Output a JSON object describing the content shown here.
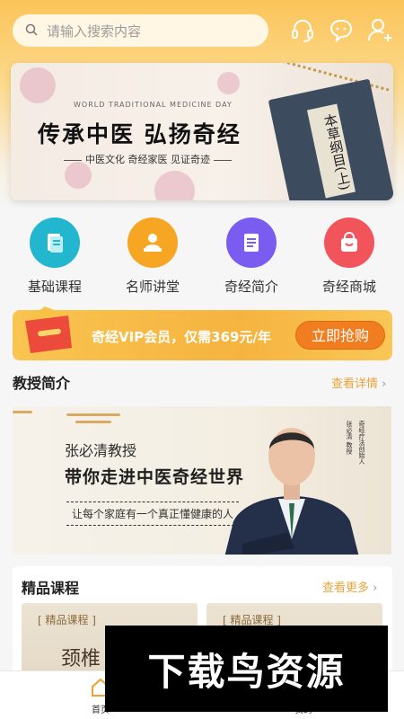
{
  "search": {
    "placeholder": "请输入搜索内容"
  },
  "header_icons": [
    "headset-icon",
    "chat-icon",
    "add-user-icon"
  ],
  "banner": {
    "subtitle": "WORLD TRADITIONAL MEDICINE DAY",
    "title": "传承中医 弘扬奇经",
    "tagline": "中医文化 奇经家医 见证奇迹",
    "book_text": "本草纲目(上)"
  },
  "quick_nav": [
    {
      "label": "基础课程",
      "icon": "document-icon",
      "color": "#23b6cf"
    },
    {
      "label": "名师讲堂",
      "icon": "lecturer-icon",
      "color": "#f6a623"
    },
    {
      "label": "奇经简介",
      "icon": "notebook-icon",
      "color": "#7a5cf0"
    },
    {
      "label": "奇经商城",
      "icon": "shopping-bag-icon",
      "color": "#f2545b"
    }
  ],
  "vip": {
    "text": "奇经VIP会员，仅需369元/年",
    "button": "立即抢购"
  },
  "professor_section": {
    "title": "教授简介",
    "more": "查看详情",
    "name": "张必清教授",
    "slogan": "带你走进中医奇经世界",
    "motto": "让每个家庭有一个真正懂健康的人",
    "vertical_left": "张必清 教授",
    "vertical_right": "奇经疗法创始人"
  },
  "courses_section": {
    "title": "精品课程",
    "more": "查看更多",
    "cards": [
      {
        "tag": "[ 精品课程 ]",
        "title": "颈椎"
      },
      {
        "tag": "[ 精品课程 ]",
        "title": ""
      }
    ]
  },
  "tabbar": {
    "home": "首页",
    "mine": "我的"
  },
  "watermark": "下载鸟资源",
  "colors": {
    "accent": "#f6b33f",
    "more_link": "#e9a43a",
    "vip_button": "#f07d20"
  }
}
